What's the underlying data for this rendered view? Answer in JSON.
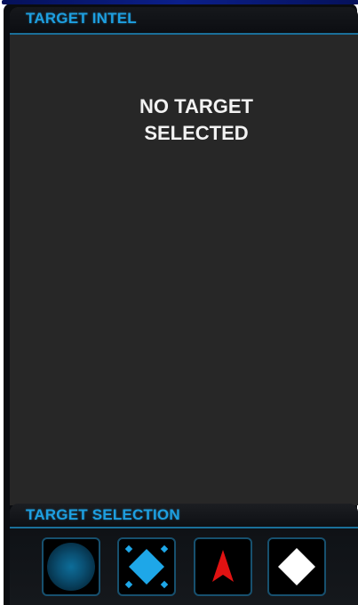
{
  "intel_panel": {
    "title": "TARGET INTEL",
    "message": "NO TARGET\nSELECTED"
  },
  "selection_panel": {
    "title": "TARGET SELECTION",
    "buttons": [
      {
        "icon": "blue-sphere-icon",
        "color": "#0a4a6b"
      },
      {
        "icon": "blue-diamond-icon",
        "color": "#1ea7e8"
      },
      {
        "icon": "red-arrow-icon",
        "color": "#e01212"
      },
      {
        "icon": "white-diamond-icon",
        "color": "#ffffff"
      }
    ]
  },
  "colors": {
    "accent": "#1e9fe0",
    "panel_bg": "#272727",
    "frame_bg": "#0a0c10",
    "button_border": "#17506e"
  }
}
